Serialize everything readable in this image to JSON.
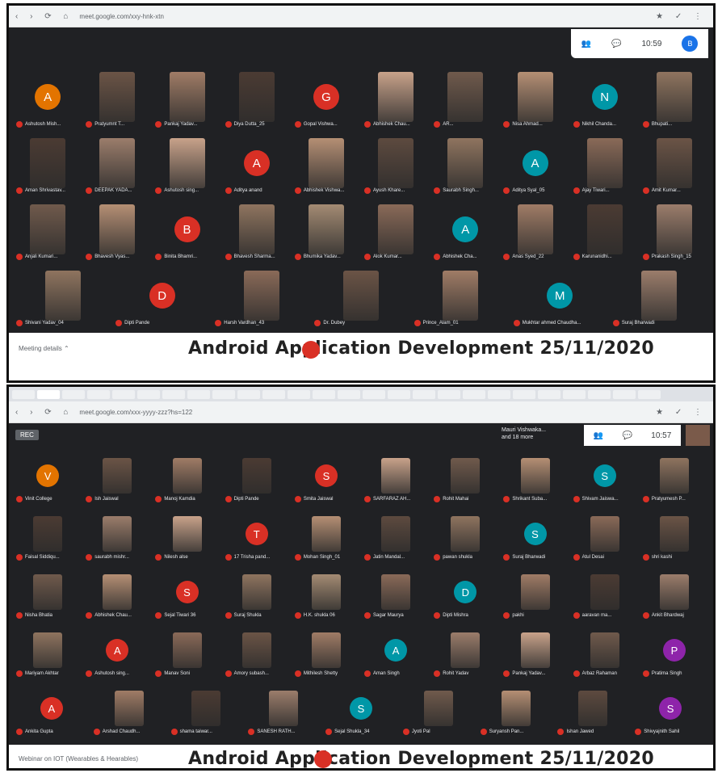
{
  "colors": {
    "meet_bg": "#202124",
    "mic_red": "#d93025",
    "accent": "#1a73e8"
  },
  "screen1": {
    "url": "meet.google.com/xxy-hnk-xtn",
    "clock": "10:59",
    "avatar_letter": "B",
    "tiles": [
      [
        "Ashutosh Mish...",
        "Pratyumnt T...",
        "Pankaj Yadav...",
        "Diya Dutta_25",
        "Gopal Vishwa...",
        "Abhishek Chau...",
        "AR...",
        "Nisa Ahmad...",
        "Nikhil Chanda...",
        "Bhupati..."
      ],
      [
        "Aman Shrivastav...",
        "DEEPAK YADA...",
        "Ashutosh sing...",
        "Aditya anand",
        "Abhishek Vishwa...",
        "Ayush Khare...",
        "Saurabh Singh...",
        "Aditya Syal_05",
        "Ajay Tiwari...",
        "Amit Kumar..."
      ],
      [
        "Anjali Kumari...",
        "Bhavesh Vyas...",
        "Binita Bhamri...",
        "Bhavesh Sharma...",
        "Bhumika Yadav...",
        "Alok Kumar...",
        "Abhishek Cha...",
        "Anas Syed_22",
        "Karunanidhi...",
        "Prakash Singh_15"
      ],
      [
        "Shivani Yadav_04",
        "Dipti Pande",
        "Harsh Vardhan_43",
        "Dr. Dubey",
        "Prince_Alam_01",
        "Mukhtar ahmed Chaudha...",
        "Suraj Bharwadi"
      ]
    ],
    "caption": "Android Application Development 25/11/2020",
    "meeting_details": "Meeting details"
  },
  "screen2": {
    "url": "meet.google.com/xxx-yyyy-zzz?hs=122",
    "rec": "REC",
    "others": [
      "Mauri Vishwaka...",
      "and 18 more"
    ],
    "clock": "10:57",
    "tiles": [
      [
        "Vinit College",
        "Ish Jaiswal",
        "Manoj Kamdia",
        "Dipti Pande",
        "Smita Jaiswal",
        "SARFARAZ AH...",
        "Rohit Mahai",
        "Shrikant Suba...",
        "Shivam Jaiswa...",
        "Pratyumesh P..."
      ],
      [
        "Faisal Siddiqu...",
        "saurabh mishr...",
        "Nilesh alse",
        "17 Trisha pand...",
        "Mohan Singh_01",
        "Jatin Mandal...",
        "pawan shukla",
        "Suraj Bharwadi",
        "Atul Desai",
        "shri kashi"
      ],
      [
        "Nisha Bhatia",
        "Abhishek Chau...",
        "Sejal Tiwari 36",
        "Suraj Shukla",
        "H.K. shukla 06",
        "Sagar Maurya",
        "Dipti Mishra",
        "pakhi",
        "aaravan ma...",
        "Ankit Bhardwaj"
      ],
      [
        "Mariyam Akhtar",
        "Ashutosh sing...",
        "Manav Soni",
        "Amory subash...",
        "Mithilesh Shetty",
        "Aman Singh",
        "Rohit Yadav",
        "Pankaj Yadav...",
        "Arbaz Rahaman",
        "Pratima Singh"
      ],
      [
        "Ankita Gupta",
        "Arshad Chaudh...",
        "shama taiwar...",
        "SANESH RATH...",
        "Sejal Shukla_34",
        "Jyoti Pal",
        "Suryansh Pan...",
        "Ishan Jawed",
        "Shivyajnith Sahil"
      ]
    ],
    "caption": "Android Application Development 25/11/2020",
    "webinar": "Webinar on IOT (Wearables & Hearables)"
  }
}
